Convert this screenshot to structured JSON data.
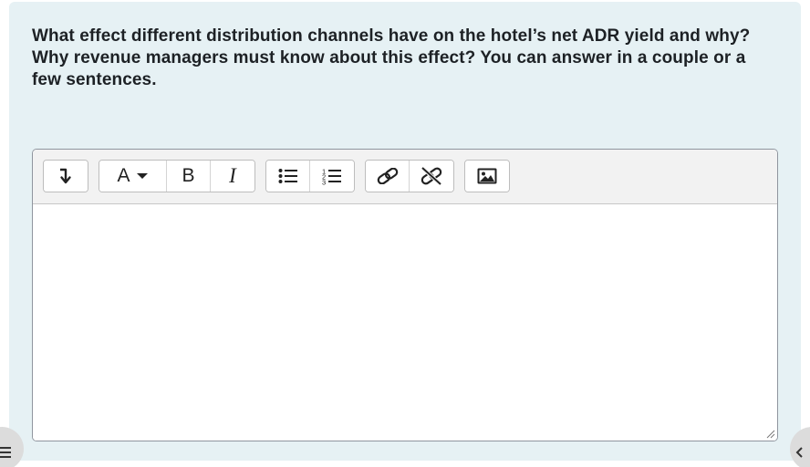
{
  "question": {
    "text": "What effect different distribution channels have on the hotel’s net ADR yield and why? Why revenue managers must know about this effect? You can answer in a couple or a few sentences."
  },
  "editor": {
    "content": "",
    "toolbar": {
      "groups": [
        {
          "buttons": [
            {
              "icon": "collapse-toolbar-icon"
            }
          ]
        },
        {
          "buttons": [
            {
              "icon": "font-color-icon",
              "label": "A"
            },
            {
              "icon": "bold-icon",
              "label": "B"
            },
            {
              "icon": "italic-icon",
              "label": "I"
            }
          ]
        },
        {
          "buttons": [
            {
              "icon": "unordered-list-icon"
            },
            {
              "icon": "ordered-list-icon"
            }
          ]
        },
        {
          "buttons": [
            {
              "icon": "link-icon"
            },
            {
              "icon": "unlink-icon"
            }
          ]
        },
        {
          "buttons": [
            {
              "icon": "image-icon"
            }
          ]
        }
      ]
    }
  },
  "colors": {
    "panel_background": "#e6f1f4",
    "text": "#1d2125",
    "toolbar_background": "#f2f2f2",
    "border": "#8f959e"
  }
}
